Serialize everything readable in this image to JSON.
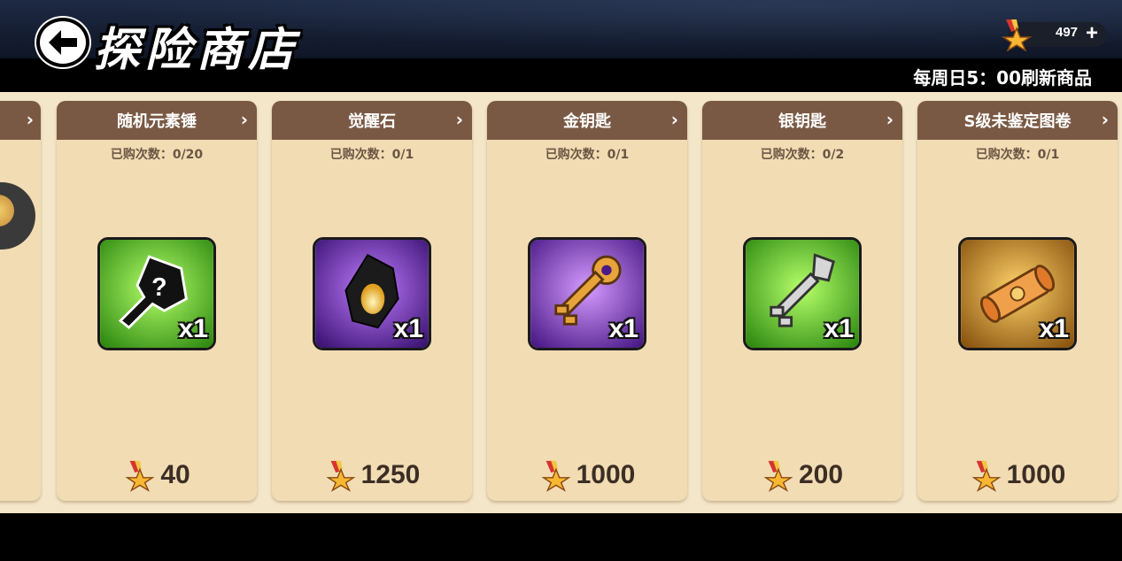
{
  "header": {
    "title": "探险商店",
    "back_icon": "back-arrow-icon",
    "currency": {
      "icon": "medal-star-icon",
      "value": "497",
      "plus_label": "+"
    },
    "refresh_note": "每周日5：00刷新商品"
  },
  "shop": {
    "items": [
      {
        "name": "随机元素锤",
        "count": "已购次数：0/20",
        "qty": "x1",
        "price": "40",
        "icon": "mystery-hammer-icon",
        "bg": "green"
      },
      {
        "name": "觉醒石",
        "count": "已购次数：0/1",
        "qty": "x1",
        "price": "1250",
        "icon": "awakening-stone-icon",
        "bg": "purple"
      },
      {
        "name": "金钥匙",
        "count": "已购次数：0/1",
        "qty": "x1",
        "price": "1000",
        "icon": "gold-key-icon",
        "bg": "purple"
      },
      {
        "name": "银钥匙",
        "count": "已购次数：0/2",
        "qty": "x1",
        "price": "200",
        "icon": "silver-key-icon",
        "bg": "green"
      },
      {
        "name": "S级未鉴定图卷",
        "count": "已购次数：0/1",
        "qty": "x1",
        "price": "1000",
        "icon": "scroll-icon",
        "bg": "gold"
      }
    ],
    "card_arrow": "›"
  },
  "colors": {
    "card_header": "#7a5944",
    "card_body": "#f2dcb4",
    "shop_bg": "#f4e6c8",
    "green": "#4fb82a",
    "purple": "#6b2fb0",
    "gold": "#c88a2a"
  }
}
